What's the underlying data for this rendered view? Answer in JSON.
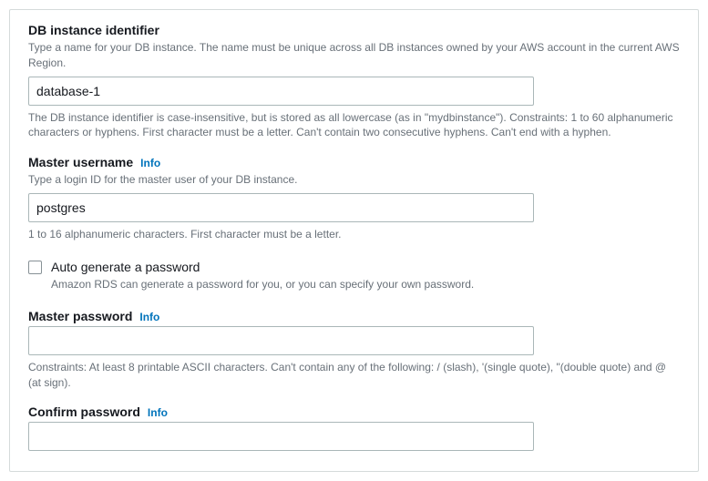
{
  "fields": {
    "db_identifier": {
      "label": "DB instance identifier",
      "description": "Type a name for your DB instance. The name must be unique across all DB instances owned by your AWS account in the current AWS Region.",
      "value": "database-1",
      "hint": "The DB instance identifier is case-insensitive, but is stored as all lowercase (as in \"mydbinstance\"). Constraints: 1 to 60 alphanumeric characters or hyphens. First character must be a letter. Can't contain two consecutive hyphens. Can't end with a hyphen."
    },
    "master_username": {
      "label": "Master username",
      "info": "Info",
      "description": "Type a login ID for the master user of your DB instance.",
      "value": "postgres",
      "hint": "1 to 16 alphanumeric characters. First character must be a letter."
    },
    "auto_generate": {
      "label": "Auto generate a password",
      "description": "Amazon RDS can generate a password for you, or you can specify your own password."
    },
    "master_password": {
      "label": "Master password",
      "info": "Info",
      "hint": "Constraints: At least 8 printable ASCII characters. Can't contain any of the following: / (slash), '(single quote), \"(double quote) and @ (at sign)."
    },
    "confirm_password": {
      "label": "Confirm password",
      "info": "Info"
    }
  }
}
